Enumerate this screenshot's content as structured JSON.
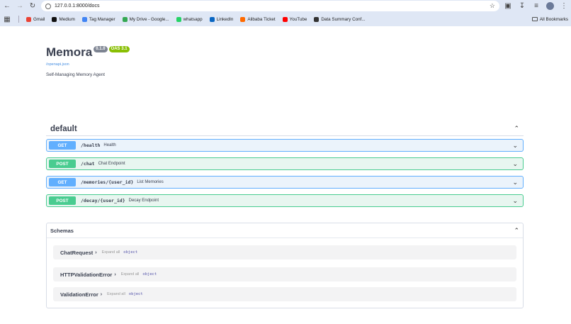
{
  "browser": {
    "url": "127.0.0.1:8000/docs",
    "bookmarks": [
      {
        "label": "Gmail",
        "color": "#ea4335"
      },
      {
        "label": "Medium",
        "color": "#111111"
      },
      {
        "label": "Tag Manager",
        "color": "#4285f4"
      },
      {
        "label": "My Drive - Google...",
        "color": "#34a853"
      },
      {
        "label": "whatsapp",
        "color": "#25d366"
      },
      {
        "label": "LinkedIn",
        "color": "#0a66c2"
      },
      {
        "label": "Alibaba Ticket",
        "color": "#ff6a00"
      },
      {
        "label": "YouTube",
        "color": "#ff0000"
      },
      {
        "label": "Data Summary Conf...",
        "color": "#333333"
      }
    ],
    "all_bookmarks": "All Bookmarks"
  },
  "info": {
    "title": "Memora",
    "version": "0.1.0",
    "oas": "OAS 3.1",
    "openapi_link": "/openapi.json",
    "description": "Self-Managing Memory Agent"
  },
  "tag": {
    "name": "default"
  },
  "operations": [
    {
      "method": "GET",
      "path": "/health",
      "summary": "Health"
    },
    {
      "method": "POST",
      "path": "/chat",
      "summary": "Chat Endpoint"
    },
    {
      "method": "GET",
      "path": "/memories/{user_id}",
      "summary": "List Memories"
    },
    {
      "method": "POST",
      "path": "/decay/{user_id}",
      "summary": "Decay Endpoint"
    }
  ],
  "schemas": {
    "title": "Schemas",
    "expand_label": "Expand all",
    "models": [
      {
        "name": "ChatRequest",
        "type": "object"
      },
      {
        "name": "HTTPValidationError",
        "type": "object"
      },
      {
        "name": "ValidationError",
        "type": "object"
      }
    ]
  }
}
